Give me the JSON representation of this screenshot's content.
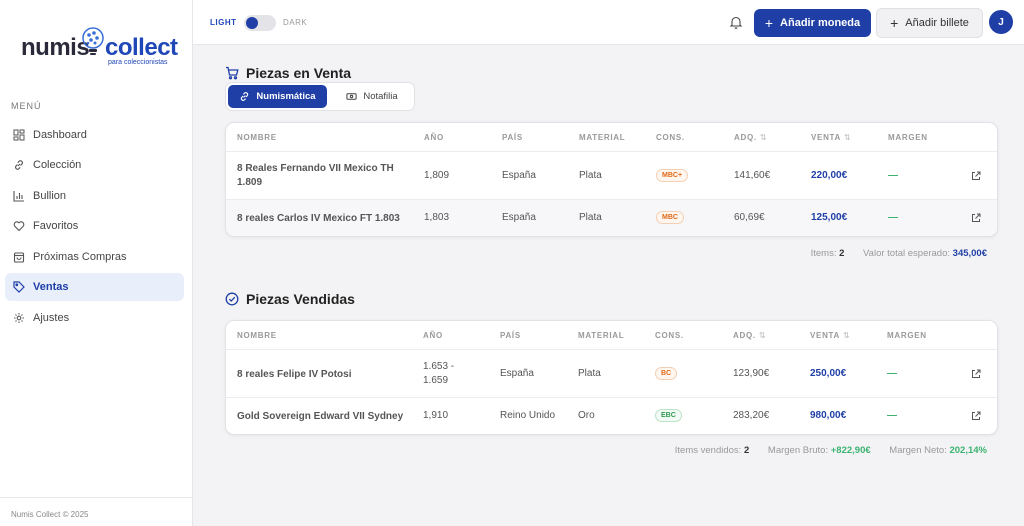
{
  "app": {
    "logo_numis": "numis",
    "logo_collect": "collect",
    "logo_tagline": "para coleccionistas"
  },
  "sidebar": {
    "menu_title": "MENÚ",
    "items": [
      {
        "label": "Dashboard",
        "icon": "dashboard-icon"
      },
      {
        "label": "Colección",
        "icon": "link-icon"
      },
      {
        "label": "Bullion",
        "icon": "bar-chart-icon"
      },
      {
        "label": "Favoritos",
        "icon": "heart-icon"
      },
      {
        "label": "Próximas Compras",
        "icon": "shopping-bag-icon"
      },
      {
        "label": "Ventas",
        "icon": "tag-icon",
        "active": true
      },
      {
        "label": "Ajustes",
        "icon": "gear-icon"
      }
    ],
    "footer": "Numis Collect © 2025"
  },
  "header": {
    "theme_light": "LIGHT",
    "theme_dark": "DARK",
    "add_coin": "Añadir moneda",
    "add_banknote": "Añadir billete",
    "avatar_initial": "J"
  },
  "colors": {
    "primary": "#1f3fa6",
    "success": "#3cb371",
    "badge_orange": "#e06a18",
    "badge_green": "#2f9a4f"
  },
  "for_sale": {
    "title": "Piezas en Venta",
    "tabs": [
      {
        "label": "Numismática",
        "active": true
      },
      {
        "label": "Notafilia",
        "active": false
      }
    ],
    "columns": [
      "NOMBRE",
      "AÑO",
      "PAÍS",
      "MATERIAL",
      "CONS.",
      "ADQ.",
      "VENTA",
      "MARGEN"
    ],
    "sort_icon": "⇅",
    "rows": [
      {
        "name": "8 Reales Fernando VII Mexico TH 1.809",
        "year": "1,809",
        "country": "España",
        "material": "Plata",
        "condition": "MBC+",
        "cond_color": "orange",
        "acquired": "141,60€",
        "sale": "220,00€",
        "margin": "—"
      },
      {
        "name": "8 reales Carlos IV Mexico FT 1.803",
        "year": "1,803",
        "country": "España",
        "material": "Plata",
        "condition": "MBC",
        "cond_color": "orange",
        "acquired": "60,69€",
        "sale": "125,00€",
        "margin": "—"
      }
    ],
    "summary": {
      "items_label": "Items:",
      "items_value": "2",
      "expected_label": "Valor total esperado:",
      "expected_value": "345,00€"
    }
  },
  "sold": {
    "title": "Piezas Vendidas",
    "columns": [
      "NOMBRE",
      "AÑO",
      "PAÍS",
      "MATERIAL",
      "CONS.",
      "ADQ.",
      "VENTA",
      "MARGEN"
    ],
    "rows": [
      {
        "name": "8 reales Felipe IV Potosi",
        "year": "1.653 - 1.659",
        "country": "España",
        "material": "Plata",
        "condition": "BC",
        "cond_color": "orange",
        "acquired": "123,90€",
        "sale": "250,00€",
        "margin": "—"
      },
      {
        "name": "Gold Sovereign Edward VII Sydney",
        "year": "1,910",
        "country": "Reino Unido",
        "material": "Oro",
        "condition": "EBC",
        "cond_color": "green",
        "acquired": "283,20€",
        "sale": "980,00€",
        "margin": "—"
      }
    ],
    "summary": {
      "items_label": "Items vendidos:",
      "items_value": "2",
      "gross_label": "Margen Bruto:",
      "gross_value": "+822,90€",
      "net_label": "Margen Neto:",
      "net_value": "202,14%"
    }
  }
}
